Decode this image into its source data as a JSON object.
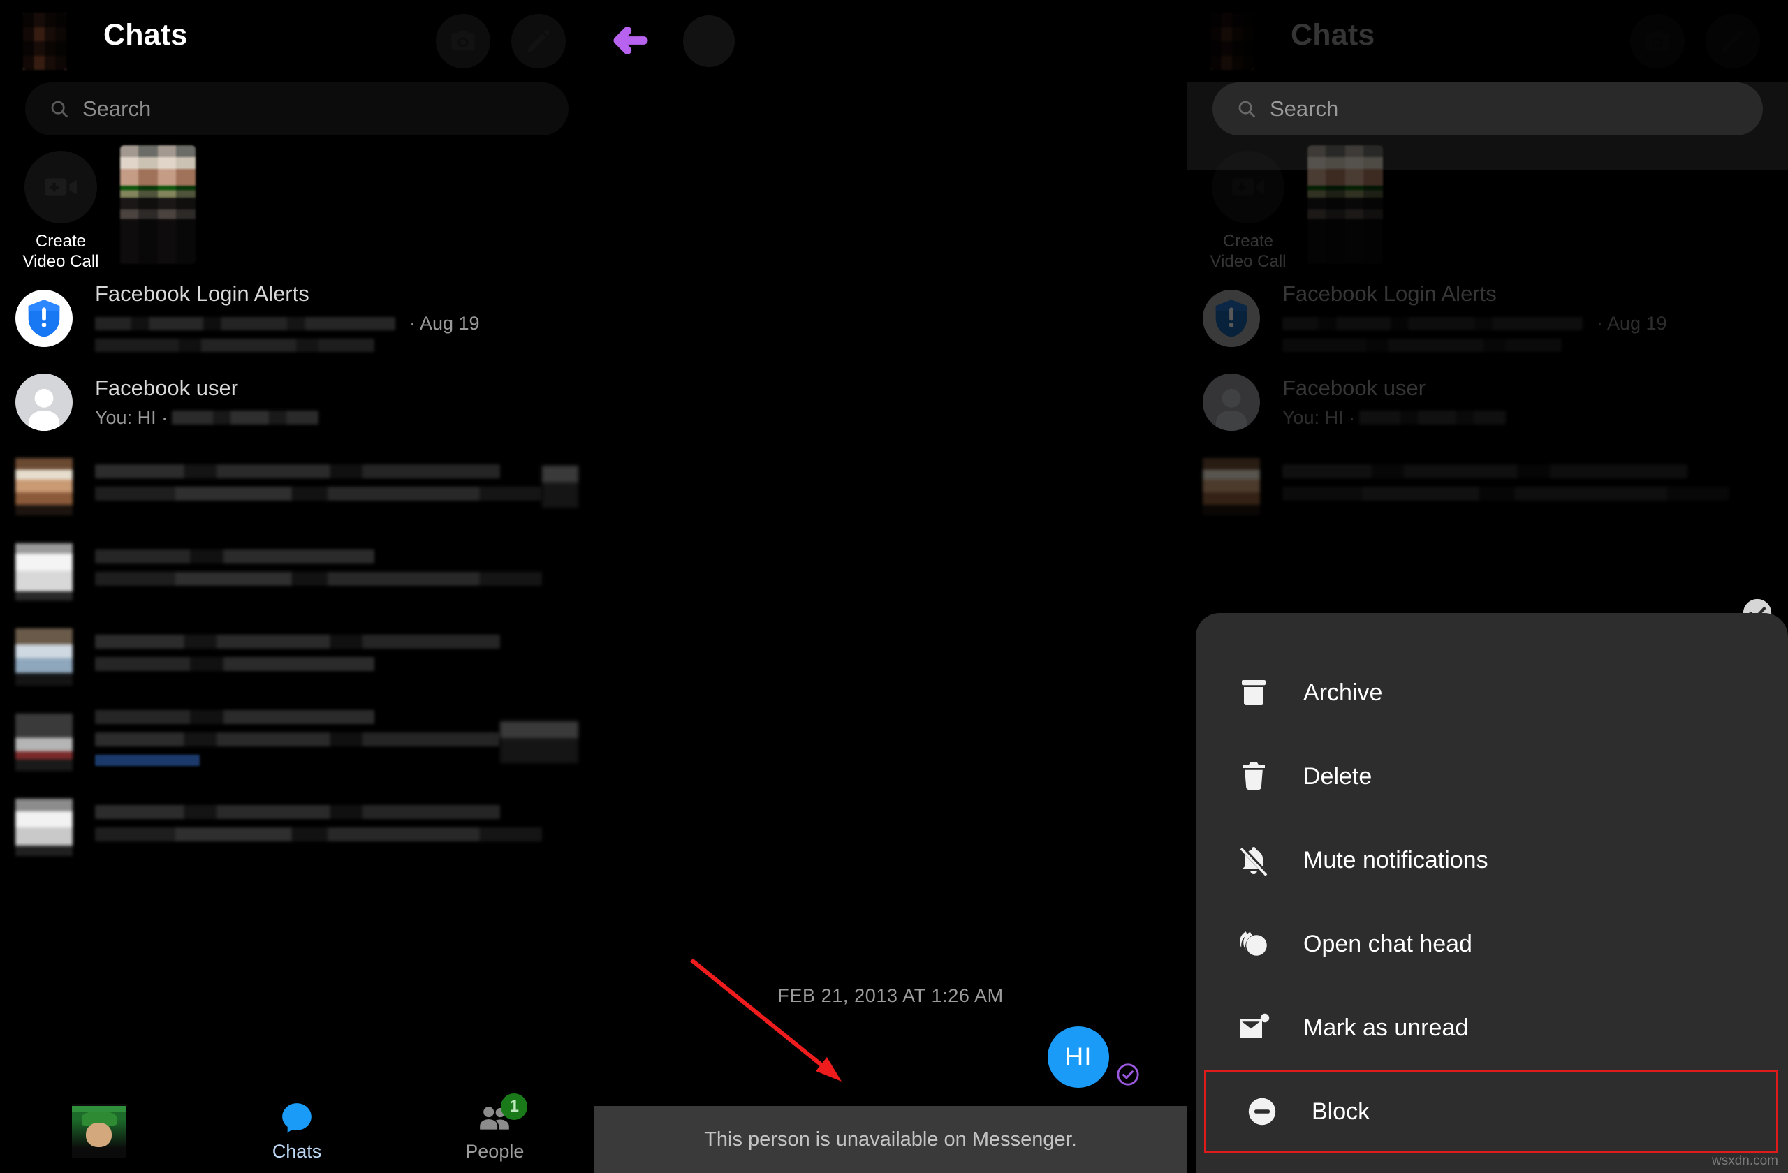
{
  "app": {
    "name": "Messenger"
  },
  "left_panel": {
    "header": {
      "title": "Chats",
      "camera_icon": "camera-icon",
      "compose_icon": "compose-pencil-icon",
      "avatar": "user-avatar"
    },
    "search": {
      "placeholder": "Search",
      "icon": "search-icon"
    },
    "video_call": {
      "label": "Create Video Call",
      "icon": "video-plus-icon"
    },
    "chats": [
      {
        "name": "Facebook Login Alerts",
        "preview": "",
        "time": "· Aug 19",
        "avatar": "shield-alert-icon"
      },
      {
        "name": "Facebook user",
        "preview": "You: HI ·",
        "time": "",
        "avatar": "default-person-icon"
      }
    ],
    "tabs": [
      {
        "label": "Chats",
        "icon": "chat-bubble-icon",
        "active": true,
        "badge": ""
      },
      {
        "label": "People",
        "icon": "people-icon",
        "active": false,
        "badge": "1"
      }
    ]
  },
  "center_panel": {
    "back_icon": "back-arrow-icon",
    "avatar": "contact-avatar",
    "date_separator": "FEB 21, 2013 AT 1:26 AM",
    "message": {
      "text": "HI",
      "sender": "you",
      "status_icon": "delivered-check-icon"
    },
    "banner": "This person is unavailable on Messenger.",
    "annotation": {
      "type": "red-arrow",
      "color": "#ee1c1c"
    }
  },
  "right_panel": {
    "header": {
      "title": "Chats"
    },
    "search": {
      "placeholder": "Search",
      "icon": "search-icon"
    },
    "video_call": {
      "label": "Create Video Call"
    },
    "chats": [
      {
        "name": "Facebook Login Alerts",
        "time": "· Aug 19",
        "avatar": "shield-alert-icon"
      },
      {
        "name": "Facebook user",
        "preview": "You: HI ·",
        "avatar": "default-person-icon"
      }
    ],
    "selected_check_icon": "check-circle-icon",
    "context_menu": {
      "items": [
        {
          "label": "Archive",
          "icon": "archive-box-icon",
          "highlighted": false
        },
        {
          "label": "Delete",
          "icon": "trash-icon",
          "highlighted": false
        },
        {
          "label": "Mute notifications",
          "icon": "bell-slash-icon",
          "highlighted": false
        },
        {
          "label": "Open chat head",
          "icon": "chat-head-icon",
          "highlighted": false
        },
        {
          "label": "Mark as unread",
          "icon": "envelope-unread-icon",
          "highlighted": false
        },
        {
          "label": "Block",
          "icon": "block-circle-icon",
          "highlighted": true
        }
      ],
      "highlight_color": "#e01b1b"
    }
  },
  "watermark": "wsxdn.com",
  "colors": {
    "accent_blue": "#1b9bf8",
    "badge_green": "#1a7a1a",
    "back_arrow_purple": "#b862f0",
    "annotation_red": "#ee1c1c",
    "menu_bg": "#2d2d2d"
  }
}
